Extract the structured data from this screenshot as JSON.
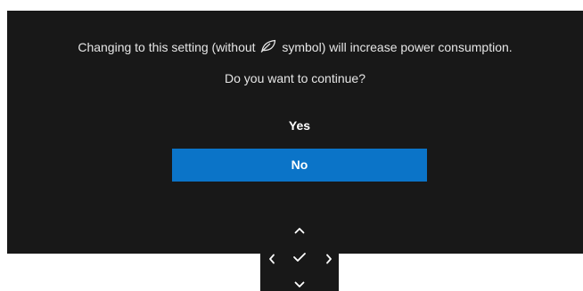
{
  "dialog": {
    "message_part1": "Changing to this setting (without",
    "message_icon": "leaf-icon",
    "message_part2": "symbol) will increase power consumption.",
    "question": "Do you want to continue?",
    "options": [
      {
        "label": "Yes",
        "selected": false
      },
      {
        "label": "No",
        "selected": true
      }
    ]
  },
  "nav_pad": {
    "buttons": [
      "chevron-up-icon",
      "chevron-left-icon",
      "check-icon",
      "chevron-right-icon",
      "chevron-down-icon"
    ]
  },
  "colors": {
    "dialog_background": "#181818",
    "selected_option": "#0b74c8",
    "text": "#e6e6e6"
  }
}
